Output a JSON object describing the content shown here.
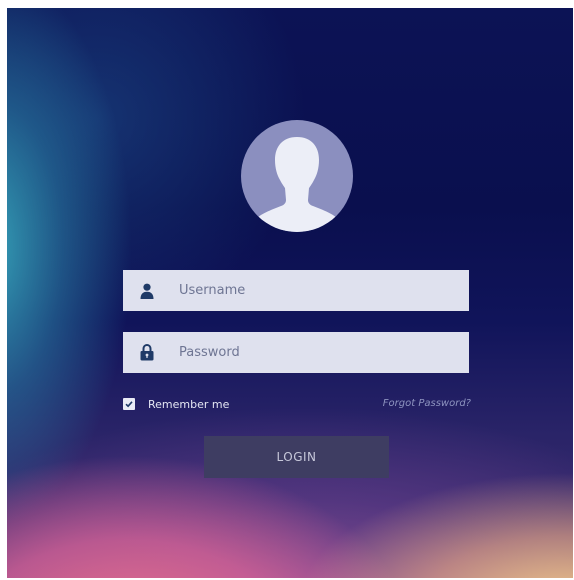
{
  "avatar": {
    "icon": "user-silhouette-icon"
  },
  "username": {
    "placeholder": "Username",
    "value": "",
    "icon": "user-icon"
  },
  "password": {
    "placeholder": "Password",
    "value": "",
    "icon": "lock-icon"
  },
  "remember": {
    "label": "Remember me",
    "checked": true
  },
  "forgot": {
    "label": "Forgot Password?"
  },
  "login": {
    "label": "LOGIN"
  },
  "colors": {
    "field_bg": "#dfe1ee",
    "icon": "#1f3a67",
    "button_bg": "#3e3d62",
    "avatar_bg": "#8b8fbf",
    "silhouette": "#eceef7"
  }
}
